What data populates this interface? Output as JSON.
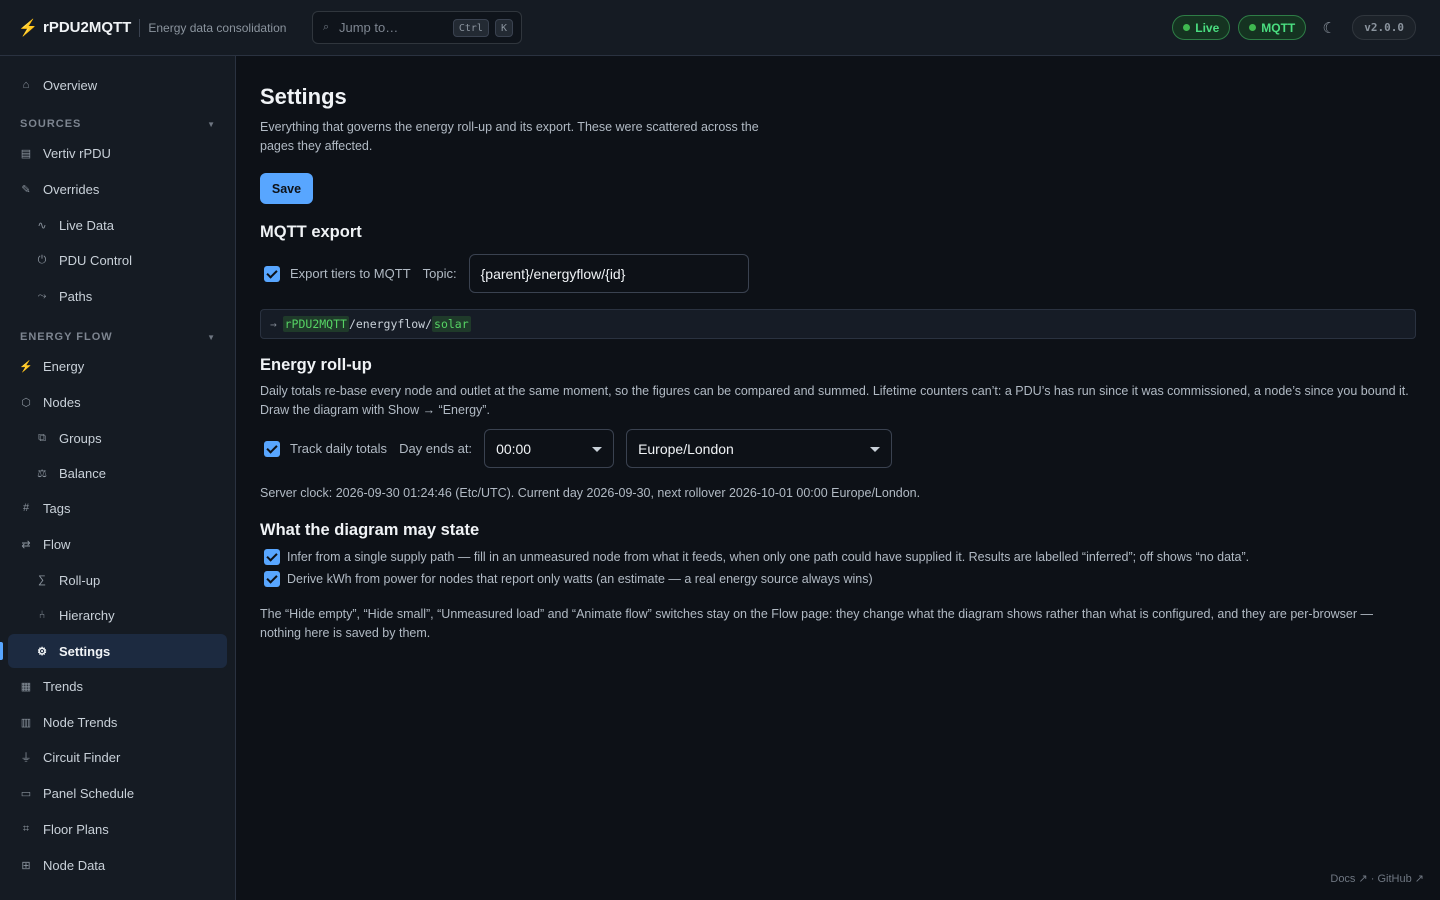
{
  "header": {
    "brand_icon": "bolt-icon",
    "brand_name": "rPDU2MQTT",
    "tagline": "Energy data consolidation",
    "search_placeholder": "Jump to…",
    "search_icon": "search-icon",
    "kbd_ctrl": "Ctrl",
    "kbd_k": "K",
    "status_live": "Live",
    "status_mqtt": "MQTT",
    "theme_icon": "moon-icon",
    "version": "v2.0.0",
    "status_color": "#3fb950"
  },
  "sidebar": {
    "overview": "Overview",
    "sources_label": "SOURCES",
    "sources": [
      {
        "label": "Vertiv rPDU",
        "icon": "server-icon"
      },
      {
        "label": "Overrides",
        "icon": "pencil-icon"
      },
      {
        "label": "Live Data",
        "icon": "wave-icon"
      },
      {
        "label": "PDU Control",
        "icon": "power-icon"
      },
      {
        "label": "Paths",
        "icon": "path-icon"
      }
    ],
    "energy_flow_label": "ENERGY FLOW",
    "energy_flow": [
      {
        "label": "Energy",
        "icon": "bolt-icon"
      },
      {
        "label": "Nodes",
        "icon": "hexagon-icon"
      },
      {
        "label": "Groups",
        "icon": "groups-icon"
      },
      {
        "label": "Balance",
        "icon": "scale-icon"
      },
      {
        "label": "Tags",
        "icon": "hash-icon"
      },
      {
        "label": "Flow",
        "icon": "flow-icon"
      },
      {
        "label": "Roll-up",
        "icon": "sigma-icon"
      },
      {
        "label": "Hierarchy",
        "icon": "tree-icon"
      },
      {
        "label": "Settings",
        "icon": "gear-icon"
      },
      {
        "label": "Trends",
        "icon": "chart-icon"
      },
      {
        "label": "Node Trends",
        "icon": "node-chart-icon"
      },
      {
        "label": "Circuit Finder",
        "icon": "plug-icon"
      },
      {
        "label": "Panel Schedule",
        "icon": "panel-icon"
      },
      {
        "label": "Floor Plans",
        "icon": "floorplan-icon"
      },
      {
        "label": "Node Data",
        "icon": "grid-icon"
      }
    ],
    "accent_color": "#58a6ff"
  },
  "main": {
    "title": "Settings",
    "description": "Everything that governs the energy roll-up and its export. These were scattered across the pages they affected.",
    "save_label": "Save",
    "mqtt": {
      "heading": "MQTT export",
      "export_label": "Export tiers to MQTT",
      "export_checked": true,
      "topic_label": "Topic:",
      "topic_value": "{parent}/energyflow/{id}",
      "preview_arrow": "→",
      "preview_prefix": "rPDU2MQTT",
      "preview_middle": "/energyflow/",
      "preview_suffix": "solar"
    },
    "rollup": {
      "heading": "Energy roll-up",
      "description": "Daily totals re-base every node and outlet at the same moment, so the figures can be compared and summed. Lifetime counters can’t: a PDU’s has run since it was commissioned, a node’s since you bound it. Draw the diagram with Show → “Energy”.",
      "track_label": "Track daily totals",
      "track_checked": true,
      "day_ends_label": "Day ends at:",
      "day_end_value": "00:00",
      "timezone_value": "Europe/London",
      "server_clock": "Server clock: 2026-09-30 01:24:46 (Etc/UTC). Current day 2026-09-30, next rollover 2026-10-01 00:00 Europe/London."
    },
    "diagram": {
      "heading": "What the diagram may state",
      "options": [
        {
          "label": "Infer from a single supply path — fill in an unmeasured node from what it feeds, when only one path could have supplied it. Results are labelled “inferred”; off shows “no data”.",
          "checked": true
        },
        {
          "label": "Derive kWh from power for nodes that report only watts (an estimate — a real energy source always wins)",
          "checked": true
        }
      ],
      "note": "The “Hide empty”, “Hide small”, “Unmeasured load” and “Animate flow” switches stay on the Flow page: they change what the diagram shows rather than what is configured, and they are per-browser — nothing here is saved by them."
    }
  },
  "footer": {
    "links": "Docs ↗ · GitHub ↗"
  }
}
